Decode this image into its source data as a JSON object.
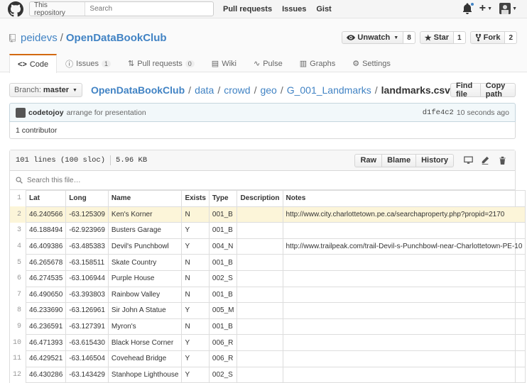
{
  "header": {
    "scope_label": "This repository",
    "search_placeholder": "Search",
    "nav": [
      "Pull requests",
      "Issues",
      "Gist"
    ]
  },
  "repo": {
    "owner": "peidevs",
    "name": "OpenDataBookClub",
    "actions": {
      "watch_label": "Unwatch",
      "watch_count": "8",
      "star_label": "Star",
      "star_count": "1",
      "fork_label": "Fork",
      "fork_count": "2"
    },
    "tabs": {
      "code": "Code",
      "issues": "Issues",
      "issues_count": "1",
      "pulls": "Pull requests",
      "pulls_count": "0",
      "wiki": "Wiki",
      "pulse": "Pulse",
      "graphs": "Graphs",
      "settings": "Settings"
    }
  },
  "file_nav": {
    "branch_prefix": "Branch:",
    "branch": "master",
    "path": [
      "OpenDataBookClub",
      "data",
      "crowd",
      "geo",
      "G_001_Landmarks"
    ],
    "file": "landmarks.csv",
    "find_file": "Find file",
    "copy_path": "Copy path"
  },
  "commit": {
    "author": "codetojoy",
    "message": "arrange for presentation",
    "sha": "d1fe4c2",
    "time": "10 seconds ago",
    "contributors": "1 contributor"
  },
  "file": {
    "lines": "101 lines (100 sloc)",
    "size": "5.96 KB",
    "raw": "Raw",
    "blame": "Blame",
    "history": "History",
    "search_placeholder": "Search this file…"
  },
  "table": {
    "columns": [
      "Lat",
      "Long",
      "Name",
      "Exists",
      "Type",
      "Description",
      "Notes"
    ],
    "rows": [
      {
        "ln": "2",
        "cells": [
          "46.240566",
          "-63.125309",
          "Ken's Korner",
          "N",
          "001_B",
          "",
          "http://www.city.charlottetown.pe.ca/searchaproperty.php?propid=2170"
        ]
      },
      {
        "ln": "3",
        "cells": [
          "46.188494",
          "-62.923969",
          "Busters Garage",
          "Y",
          "001_B",
          "",
          ""
        ]
      },
      {
        "ln": "4",
        "cells": [
          "46.409386",
          "-63.485383",
          "Devil's Punchbowl",
          "Y",
          "004_N",
          "",
          "http://www.trailpeak.com/trail-Devil-s-Punchbowl-near-Charlottetown-PE-10"
        ]
      },
      {
        "ln": "5",
        "cells": [
          "46.265678",
          "-63.158511",
          "Skate Country",
          "N",
          "001_B",
          "",
          ""
        ]
      },
      {
        "ln": "6",
        "cells": [
          "46.274535",
          "-63.106944",
          "Purple House",
          "N",
          "002_S",
          "",
          ""
        ]
      },
      {
        "ln": "7",
        "cells": [
          "46.490650",
          "-63.393803",
          "Rainbow Valley",
          "N",
          "001_B",
          "",
          ""
        ]
      },
      {
        "ln": "8",
        "cells": [
          "46.233690",
          "-63.126961",
          "Sir John A Statue",
          "Y",
          "005_M",
          "",
          ""
        ]
      },
      {
        "ln": "9",
        "cells": [
          "46.236591",
          "-63.127391",
          "Myron's",
          "N",
          "001_B",
          "",
          ""
        ]
      },
      {
        "ln": "10",
        "cells": [
          "46.471393",
          "-63.615430",
          "Black Horse Corner",
          "Y",
          "006_R",
          "",
          ""
        ]
      },
      {
        "ln": "11",
        "cells": [
          "46.429521",
          "-63.146504",
          "Covehead Bridge",
          "Y",
          "006_R",
          "",
          ""
        ]
      },
      {
        "ln": "12",
        "cells": [
          "46.430286",
          "-63.143429",
          "Stanhope Lighthouse",
          "Y",
          "002_S",
          "",
          ""
        ]
      }
    ],
    "header_ln": "1"
  }
}
